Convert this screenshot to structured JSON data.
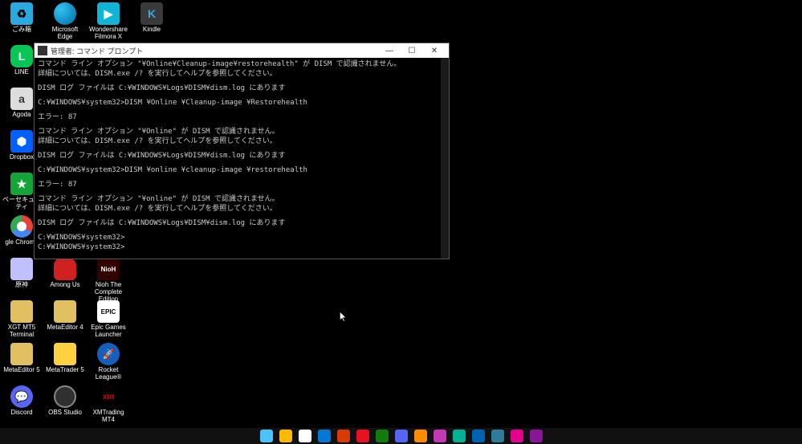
{
  "desktop": {
    "columns": [
      [
        {
          "label": "ごみ箱",
          "icon": "recycle-bin",
          "color": "#2aa9e0"
        },
        {
          "label": "LINE",
          "icon": "line",
          "color": "#06c755"
        },
        {
          "label": "Agoda",
          "icon": "agoda",
          "color": "#dddddd"
        },
        {
          "label": "Dropbox",
          "icon": "dropbox",
          "color": "#0061ff"
        },
        {
          "label": "ペーセキュリティ",
          "icon": "security",
          "color": "#13a538"
        },
        {
          "label": "gle Chrome",
          "icon": "chrome",
          "color": "#ffffff"
        },
        {
          "label": "原神",
          "icon": "genshin",
          "color": "#c0c0ff"
        },
        {
          "label": "XGT MT5\nTerminal",
          "icon": "mt5term",
          "color": "#e0c060"
        },
        {
          "label": "MetaEditor 5",
          "icon": "metaeditor5",
          "color": "#e0c060"
        },
        {
          "label": "Discord",
          "icon": "discord",
          "color": "#5865f2"
        }
      ],
      [
        {
          "label": "Microsoft Edge",
          "icon": "edge",
          "color": "#0c87be"
        },
        {
          "label": "",
          "icon": "",
          "color": ""
        },
        {
          "label": "",
          "icon": "",
          "color": ""
        },
        {
          "label": "",
          "icon": "",
          "color": ""
        },
        {
          "label": "",
          "icon": "",
          "color": ""
        },
        {
          "label": "",
          "icon": "",
          "color": ""
        },
        {
          "label": "Among Us",
          "icon": "amongus",
          "color": "#d02020"
        },
        {
          "label": "MetaEditor 4",
          "icon": "metaeditor4",
          "color": "#e0c060"
        },
        {
          "label": "MetaTrader 5",
          "icon": "metatrader5",
          "color": "#ffd040"
        },
        {
          "label": "OBS Studio",
          "icon": "obs",
          "color": "#303030"
        }
      ],
      [
        {
          "label": "Wondershare\nFilmora X",
          "icon": "filmora",
          "color": "#10b5d6"
        },
        {
          "label": "",
          "icon": "",
          "color": ""
        },
        {
          "label": "",
          "icon": "",
          "color": ""
        },
        {
          "label": "",
          "icon": "",
          "color": ""
        },
        {
          "label": "",
          "icon": "",
          "color": ""
        },
        {
          "label": "",
          "icon": "",
          "color": ""
        },
        {
          "label": "Nioh The\nComplete Edition",
          "icon": "nioh",
          "color": "#c01010"
        },
        {
          "label": "Epic Games\nLauncher",
          "icon": "epic",
          "color": "#ffffff"
        },
        {
          "label": "Rocket League®",
          "icon": "rocketleague",
          "color": "#1560bd"
        },
        {
          "label": "XMTrading MT4",
          "icon": "xm",
          "color": "#d00000"
        }
      ],
      [
        {
          "label": "Kindle",
          "icon": "kindle",
          "color": "#3a3a3a"
        }
      ]
    ]
  },
  "terminal": {
    "title": "管理者: コマンド プロンプト",
    "lines": [
      "コマンド ライン オプション \"¥Online¥Cleanup-image¥restorehealth\" が DISM で認識されません。",
      "詳細については、DISM.exe /? を実行してヘルプを参照してください。",
      "",
      "DISM ログ ファイルは C:¥WINDOWS¥Logs¥DISM¥dism.log にあります",
      "",
      "C:¥WINDOWS¥system32>DISM ¥Online ¥Cleanup-image ¥Restorehealth",
      "",
      "エラー: 87",
      "",
      "コマンド ライン オプション \"¥Online\" が DISM で認識されません。",
      "詳細については、DISM.exe /? を実行してヘルプを参照してください。",
      "",
      "DISM ログ ファイルは C:¥WINDOWS¥Logs¥DISM¥dism.log にあります",
      "",
      "C:¥WINDOWS¥system32>DISM ¥online ¥cleanup-image ¥restorehealth",
      "",
      "エラー: 87",
      "",
      "コマンド ライン オプション \"¥online\" が DISM で認識されません。",
      "詳細については、DISM.exe /? を実行してヘルプを参照してください。",
      "",
      "DISM ログ ファイルは C:¥WINDOWS¥Logs¥DISM¥dism.log にあります",
      "",
      "C:¥WINDOWS¥system32>",
      "C:¥WINDOWS¥system32>"
    ],
    "buttons": {
      "min": "—",
      "max": "☐",
      "close": "✕"
    }
  },
  "taskbar": {
    "colors": [
      "#4cc2ff",
      "#ffb900",
      "#ffffff",
      "#0078d4",
      "#d83b01",
      "#e81123",
      "#107c10",
      "#5865f2",
      "#ff8c00",
      "#c239b3",
      "#00b294",
      "#0063b1",
      "#2d7d9a",
      "#e3008c",
      "#881798"
    ]
  }
}
